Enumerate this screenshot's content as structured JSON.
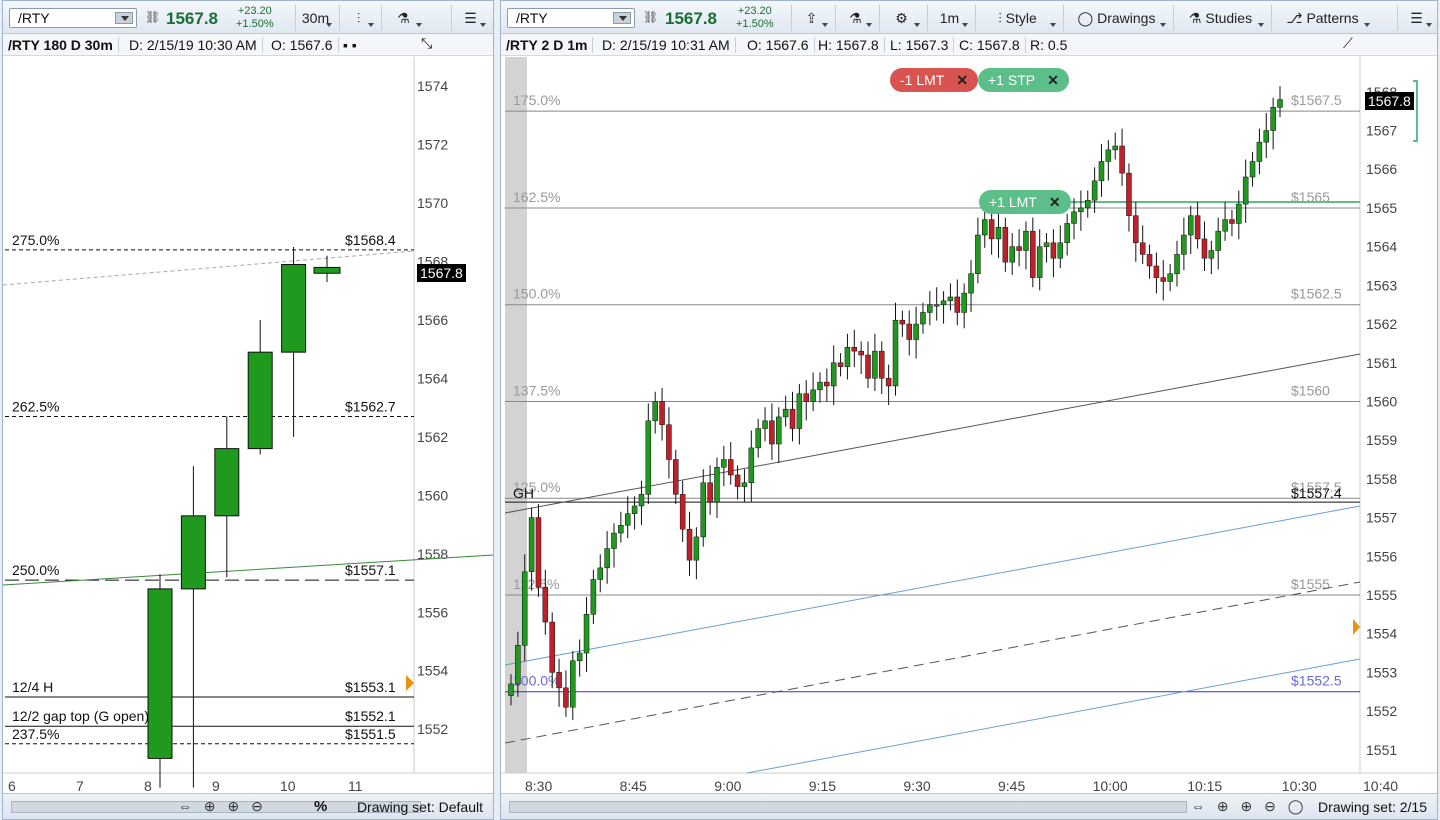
{
  "left": {
    "symbol": "/RTY",
    "last": "1567.8",
    "change": "+23.20",
    "change_pct": "+1.50%",
    "aggregation": "30m",
    "info": {
      "title": "/RTY 180 D 30m",
      "date": "D: 2/15/19 10:30 AM",
      "open": "O: 1567.6"
    },
    "price_ticks": [
      "1574",
      "1572",
      "1570",
      "1568",
      "1566",
      "1564",
      "1562",
      "1560",
      "1558",
      "1556",
      "1554",
      "1552"
    ],
    "time_ticks": [
      "6",
      "7",
      "8",
      "9",
      "10",
      "11"
    ],
    "price_tag": "1567.8",
    "levels": [
      {
        "label": "275.0%",
        "price_label": "$1568.4"
      },
      {
        "label": "262.5%",
        "price_label": "$1562.7"
      },
      {
        "label": "250.0%",
        "price_label": "$1557.1"
      },
      {
        "label": "12/4 H",
        "price_label": "$1553.1"
      },
      {
        "label": "12/2 gap top (G open)",
        "price_label": "$1552.1"
      },
      {
        "label": "237.5%",
        "price_label": "$1551.5"
      }
    ],
    "drawing_set": "Drawing set: Default",
    "pct_label": "%",
    "candles": [
      {
        "o": 1551.0,
        "h": 1557.3,
        "l": 1550.0,
        "c": 1556.8
      },
      {
        "o": 1556.8,
        "h": 1561.0,
        "l": 1550.0,
        "c": 1559.3
      },
      {
        "o": 1559.3,
        "h": 1562.7,
        "l": 1557.2,
        "c": 1561.6
      },
      {
        "o": 1561.6,
        "h": 1566.0,
        "l": 1561.4,
        "c": 1564.9
      },
      {
        "o": 1564.9,
        "h": 1568.5,
        "l": 1562.0,
        "c": 1567.9
      },
      {
        "o": 1567.6,
        "h": 1568.2,
        "l": 1567.3,
        "c": 1567.8
      }
    ]
  },
  "right": {
    "symbol": "/RTY",
    "last": "1567.8",
    "change": "+23.20",
    "change_pct": "+1.50%",
    "aggregation": "1m",
    "style_label": "Style",
    "drawings_label": "Drawings",
    "studies_label": "Studies",
    "patterns_label": "Patterns",
    "info": {
      "title": "/RTY 2 D 1m",
      "date": "D: 2/15/19 10:31 AM",
      "open": "O: 1567.6",
      "high": "H: 1567.8",
      "low": "L: 1567.3",
      "close": "C: 1567.8",
      "range": "R: 0.5"
    },
    "price_ticks": [
      "1568",
      "1567",
      "1566",
      "1565",
      "1564",
      "1563",
      "1562",
      "1561",
      "1560",
      "1559",
      "1558",
      "1557",
      "1556",
      "1555",
      "1554",
      "1553",
      "1552",
      "1551"
    ],
    "time_ticks": [
      "8:30",
      "8:45",
      "9:00",
      "9:15",
      "9:30",
      "9:45",
      "10:00",
      "10:15",
      "10:30",
      "10:40"
    ],
    "price_tag": "1567.8",
    "levels": [
      {
        "label": "175.0%",
        "price_label": "$1567.5"
      },
      {
        "label": "162.5%",
        "price_label": "$1565"
      },
      {
        "label": "150.0%",
        "price_label": "$1562.5"
      },
      {
        "label": "137.5%",
        "price_label": "$1560"
      },
      {
        "label": "125.0%",
        "price_label": "$1557.5"
      },
      {
        "label": "112.5%",
        "price_label": "$1555"
      },
      {
        "label": "100.0%",
        "price_label": "$1552.5"
      }
    ],
    "gh_label": "GH",
    "gh_price_label": "$1557.4",
    "orders": [
      {
        "text": "-1 LMT",
        "color": "#d9534f"
      },
      {
        "text": "+1 STP",
        "color": "#5cbf8a"
      },
      {
        "text": "+1 LMT",
        "color": "#5cbf8a"
      }
    ],
    "drawing_set": "Drawing set: 2/15",
    "closes": [
      1552.7,
      1553.7,
      1555.6,
      1557.0,
      1555.2,
      1554.3,
      1553.0,
      1552.6,
      1552.1,
      1553.3,
      1553.5,
      1554.5,
      1555.4,
      1555.7,
      1556.2,
      1556.6,
      1556.8,
      1557.1,
      1557.3,
      1557.6,
      1559.5,
      1560.0,
      1559.4,
      1558.5,
      1557.6,
      1556.7,
      1555.9,
      1556.5,
      1557.9,
      1557.4,
      1558.3,
      1558.5,
      1558.1,
      1557.8,
      1557.9,
      1558.8,
      1559.3,
      1559.5,
      1558.9,
      1559.6,
      1559.8,
      1559.3,
      1560.2,
      1560.0,
      1560.3,
      1560.5,
      1560.4,
      1561.0,
      1560.9,
      1561.4,
      1561.3,
      1561.2,
      1560.6,
      1561.3,
      1560.6,
      1560.4,
      1562.1,
      1562.0,
      1561.6,
      1562.0,
      1562.3,
      1562.5,
      1562.5,
      1562.6,
      1562.7,
      1562.3,
      1562.8,
      1563.3,
      1564.3,
      1564.7,
      1564.2,
      1564.5,
      1563.6,
      1564.0,
      1563.9,
      1564.4,
      1563.2,
      1564.0,
      1564.1,
      1563.7,
      1564.1,
      1564.6,
      1564.9,
      1565.0,
      1565.2,
      1565.7,
      1566.2,
      1566.5,
      1566.6,
      1565.9,
      1564.8,
      1564.1,
      1563.8,
      1563.5,
      1563.2,
      1563.1,
      1563.3,
      1563.8,
      1564.3,
      1564.8,
      1564.2,
      1563.7,
      1563.9,
      1564.4,
      1564.7,
      1564.6,
      1565.1,
      1565.8,
      1566.2,
      1566.7,
      1567.0,
      1567.6,
      1567.8
    ]
  }
}
